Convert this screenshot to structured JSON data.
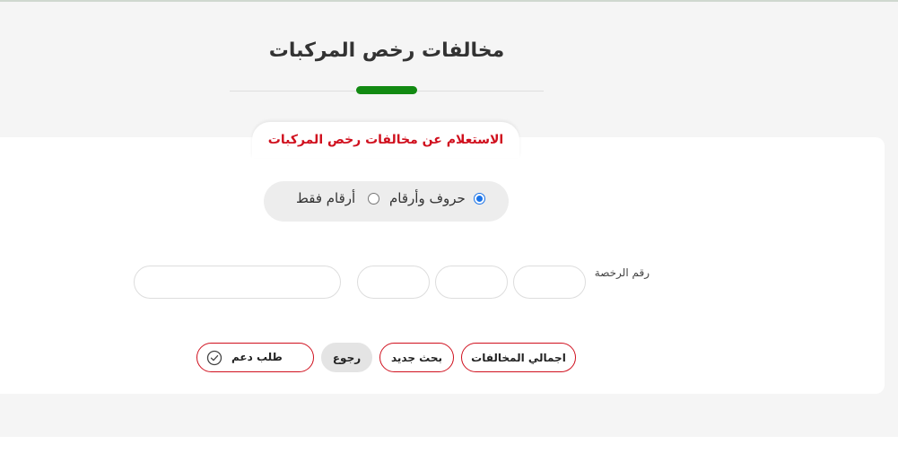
{
  "header": {
    "title": "مخالفات رخص المركبات"
  },
  "inquiry": {
    "tab_label": "الاستعلام عن مخالفات رخص المركبات",
    "mode_options": [
      {
        "label": "حروف وأرقام",
        "selected": true
      },
      {
        "label": "أرقام فقط",
        "selected": false
      }
    ],
    "license_label": "رقم الرخصة",
    "inputs": [
      {
        "value": "",
        "placeholder": ""
      },
      {
        "value": "",
        "placeholder": ""
      },
      {
        "value": "",
        "placeholder": ""
      },
      {
        "value": "",
        "placeholder": ""
      }
    ]
  },
  "actions": {
    "total_violations": "اجمالي المخالفات",
    "new_search": "بحث جديد",
    "back": "رجوع",
    "support_request": "طلب دعم",
    "support_icon": "check-circle-icon"
  },
  "colors": {
    "accent_green": "#128a12",
    "accent_red": "#d0101e",
    "radio_blue": "#1a73e8"
  }
}
